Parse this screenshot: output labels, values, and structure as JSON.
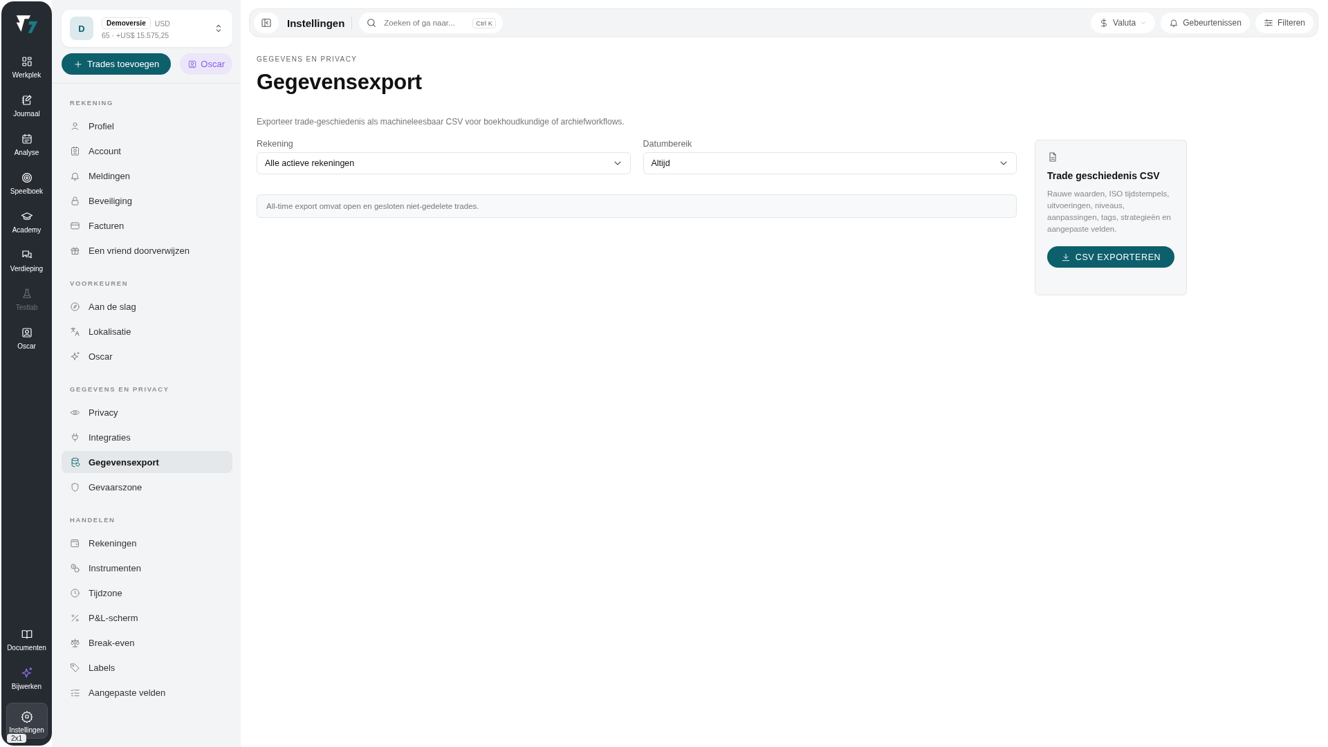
{
  "rail": {
    "items": [
      {
        "label": "Werkplek",
        "disabled": false,
        "selected": false
      },
      {
        "label": "Journaal",
        "disabled": false,
        "selected": false
      },
      {
        "label": "Analyse",
        "disabled": false,
        "selected": false
      },
      {
        "label": "Speelboek",
        "disabled": false,
        "selected": false
      },
      {
        "label": "Academy",
        "disabled": false,
        "selected": false
      },
      {
        "label": "Verdieping",
        "disabled": false,
        "selected": false
      },
      {
        "label": "Testlab",
        "disabled": true,
        "selected": false
      },
      {
        "label": "Oscar",
        "disabled": false,
        "selected": false
      }
    ],
    "bottom_items": [
      {
        "label": "Documenten",
        "selected": false
      },
      {
        "label": "Bijwerken",
        "selected": false
      },
      {
        "label": "Instellingen",
        "selected": true
      }
    ],
    "badge": "2x1"
  },
  "account": {
    "avatar": "D",
    "name": "Demoversie",
    "currency": "USD",
    "summary": "65 · +US$ 15.575,25"
  },
  "sidebar": {
    "add_button": "Trades toevoegen",
    "oscar_button": "Oscar",
    "sections": [
      {
        "title": "REKENING",
        "items": [
          {
            "label": "Profiel",
            "selected": false
          },
          {
            "label": "Account",
            "selected": false
          },
          {
            "label": "Meldingen",
            "selected": false
          },
          {
            "label": "Beveiliging",
            "selected": false
          },
          {
            "label": "Facturen",
            "selected": false
          },
          {
            "label": "Een vriend doorverwijzen",
            "selected": false
          }
        ]
      },
      {
        "title": "VOORKEUREN",
        "items": [
          {
            "label": "Aan de slag",
            "selected": false
          },
          {
            "label": "Lokalisatie",
            "selected": false
          },
          {
            "label": "Oscar",
            "selected": false
          }
        ]
      },
      {
        "title": "GEGEVENS EN PRIVACY",
        "items": [
          {
            "label": "Privacy",
            "selected": false
          },
          {
            "label": "Integraties",
            "selected": false
          },
          {
            "label": "Gegevensexport",
            "selected": true
          },
          {
            "label": "Gevaarszone",
            "selected": false
          }
        ]
      },
      {
        "title": "HANDELEN",
        "items": [
          {
            "label": "Rekeningen",
            "selected": false
          },
          {
            "label": "Instrumenten",
            "selected": false
          },
          {
            "label": "Tijdzone",
            "selected": false
          },
          {
            "label": "P&L-scherm",
            "selected": false
          },
          {
            "label": "Break-even",
            "selected": false
          },
          {
            "label": "Labels",
            "selected": false
          },
          {
            "label": "Aangepaste velden",
            "selected": false
          }
        ]
      }
    ]
  },
  "topbar": {
    "title": "Instellingen",
    "search": {
      "placeholder": "Zoeken of ga naar...",
      "shortcut": "Ctrl K"
    },
    "buttons": [
      {
        "label": "Valuta"
      },
      {
        "label": "Gebeurtenissen"
      },
      {
        "label": "Filteren"
      }
    ]
  },
  "page": {
    "breadcrumb": "GEGEVENS EN PRIVACY",
    "title": "Gegevensexport",
    "description": "Exporteer trade-geschiedenis als machineleesbaar CSV voor boekhoudkundige of archiefworkflows.",
    "fields": [
      {
        "label": "Rekening",
        "value": "Alle actieve rekeningen"
      },
      {
        "label": "Datumbereik",
        "value": "Altijd"
      }
    ],
    "note": "All-time export omvat open en gesloten niet-gedelete trades.",
    "card": {
      "title": "Trade geschiedenis CSV",
      "text": "Rauwe waarden, ISO tijdstempels, uitvoeringen, niveaus, aanpassingen, tags, strategieën en aangepaste velden.",
      "button": "CSV EXPORTEREN"
    }
  }
}
